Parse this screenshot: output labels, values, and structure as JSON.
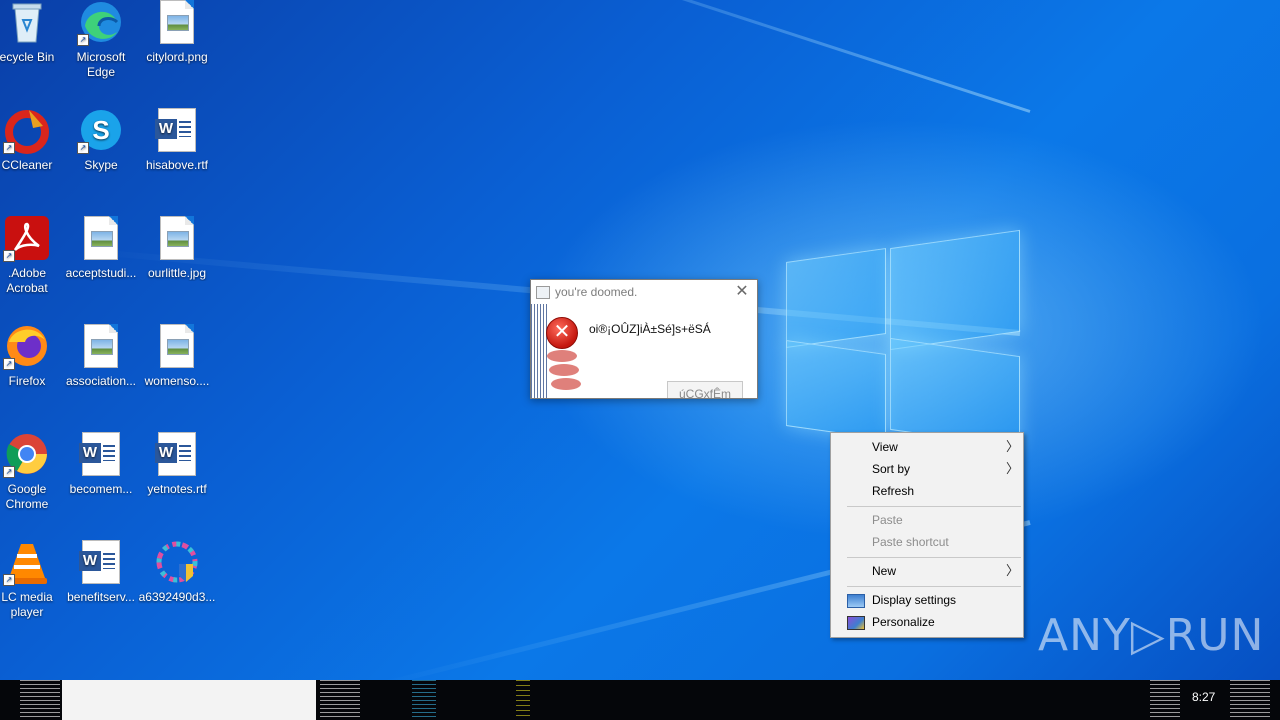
{
  "desktop": {
    "icons": [
      {
        "label": "ecycle Bin",
        "kind": "recycle-bin-icon"
      },
      {
        "label": "Microsoft Edge",
        "kind": "edge-icon"
      },
      {
        "label": "citylord.png",
        "kind": "image-file-icon"
      },
      {
        "label": "CCleaner",
        "kind": "ccleaner-icon"
      },
      {
        "label": "Skype",
        "kind": "skype-icon"
      },
      {
        "label": "hisabove.rtf",
        "kind": "word-document-icon"
      },
      {
        "label": ".Adobe Acrobat",
        "kind": "adobe-acrobat-icon"
      },
      {
        "label": "acceptstudi...",
        "kind": "image-file-icon"
      },
      {
        "label": "ourlittle.jpg",
        "kind": "image-file-icon"
      },
      {
        "label": "Firefox",
        "kind": "firefox-icon"
      },
      {
        "label": "association...",
        "kind": "image-file-icon"
      },
      {
        "label": "womenso....",
        "kind": "image-file-icon"
      },
      {
        "label": "Google Chrome",
        "kind": "chrome-icon"
      },
      {
        "label": "becomem...",
        "kind": "word-document-icon"
      },
      {
        "label": "yetnotes.rtf",
        "kind": "word-document-icon"
      },
      {
        "label": "LC media player",
        "kind": "vlc-icon"
      },
      {
        "label": "benefitserv...",
        "kind": "word-document-icon"
      },
      {
        "label": "a6392490d3...",
        "kind": "installer-icon"
      }
    ]
  },
  "dialog": {
    "title": "you're doomed.",
    "close_glyph": "✕",
    "message": "oi®¡OÛZ]iÀ±Sé]s+ëSÁ",
    "button_label": "úCGxfÊm",
    "icon": "error-icon",
    "error_glyph": "✕"
  },
  "context_menu": {
    "items": [
      {
        "label": "View",
        "submenu": true,
        "disabled": false
      },
      {
        "label": "Sort by",
        "submenu": true,
        "disabled": false
      },
      {
        "label": "Refresh",
        "submenu": false,
        "disabled": false
      },
      {
        "label": "Paste",
        "submenu": false,
        "disabled": true
      },
      {
        "label": "Paste shortcut",
        "submenu": false,
        "disabled": true
      },
      {
        "label": "New",
        "submenu": true,
        "disabled": false
      },
      {
        "label": "Display settings",
        "submenu": false,
        "disabled": false,
        "icon": "display-settings-icon"
      },
      {
        "label": "Personalize",
        "submenu": false,
        "disabled": false,
        "icon": "personalize-icon"
      }
    ],
    "arrow_glyph": "〉"
  },
  "watermark": {
    "text": "ANY▷RUN"
  },
  "taskbar": {
    "clock": "8:27"
  },
  "colors": {
    "accent": "#0a6fe0",
    "menu_bg": "#f2f2f2",
    "error_red": "#c4170e"
  }
}
